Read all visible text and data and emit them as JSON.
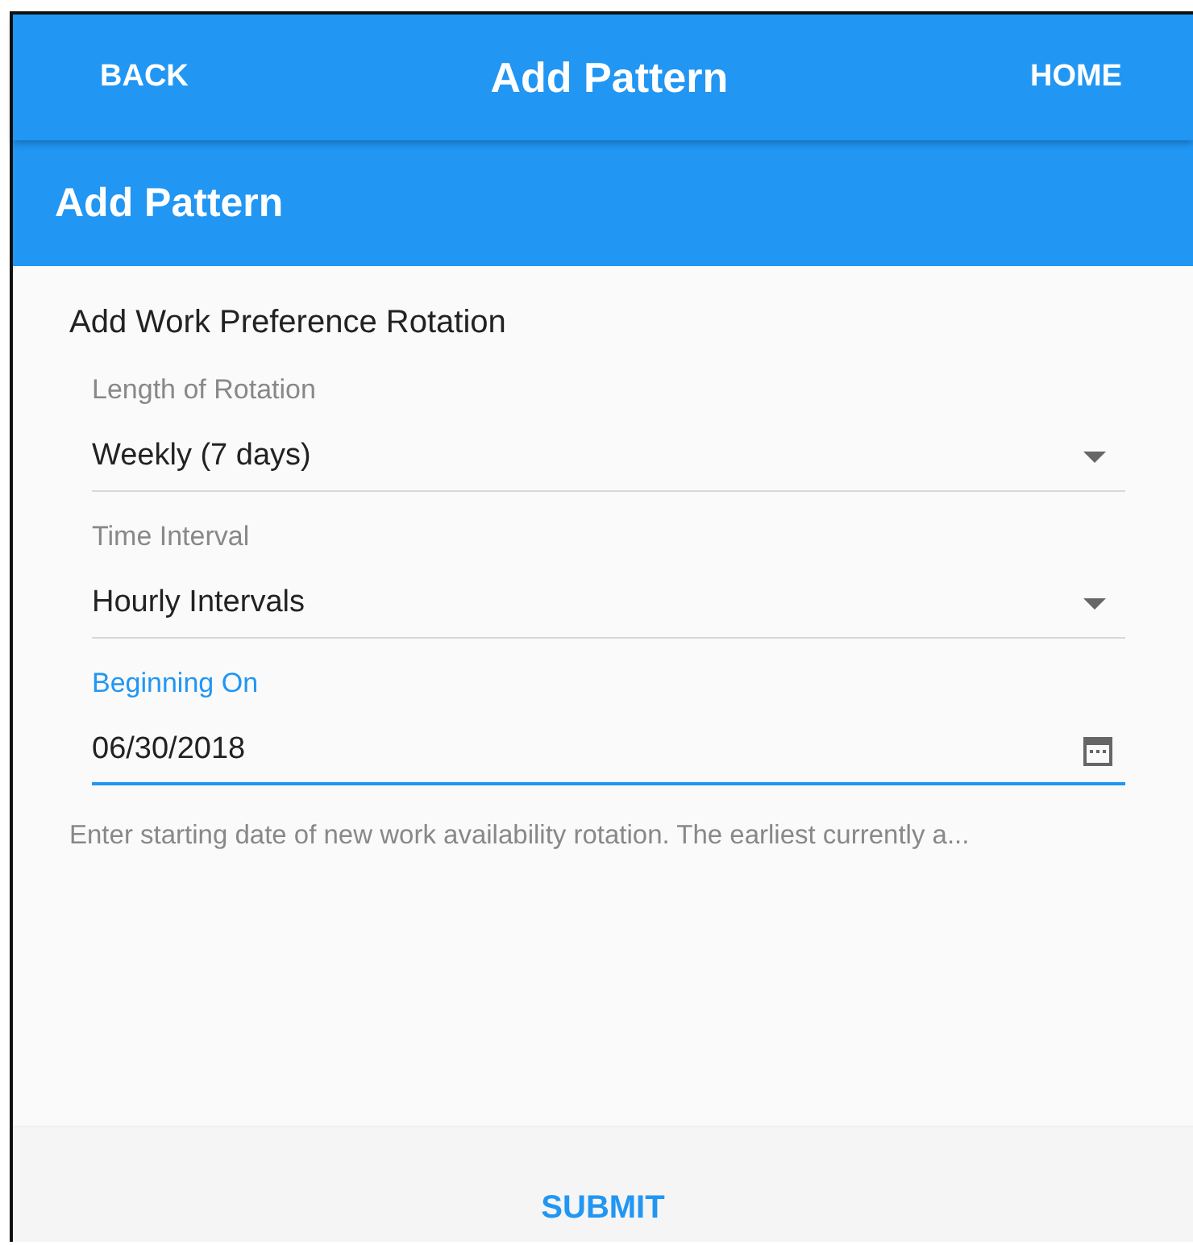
{
  "app_bar": {
    "back": "BACK",
    "title": "Add Pattern",
    "home": "HOME"
  },
  "page_header": {
    "title": "Add Pattern"
  },
  "form": {
    "title": "Add Work Preference Rotation",
    "fields": [
      {
        "kind": "select",
        "label": "Length of Rotation",
        "value": "Weekly (7 days)",
        "focused": false
      },
      {
        "kind": "select",
        "label": "Time Interval",
        "value": "Hourly Intervals",
        "focused": false
      },
      {
        "kind": "date",
        "label": "Beginning On",
        "value": "06/30/2018",
        "focused": true
      }
    ],
    "hint": "Enter starting date of new work availability rotation. The earliest currently a..."
  },
  "footer": {
    "submit": "SUBMIT"
  }
}
